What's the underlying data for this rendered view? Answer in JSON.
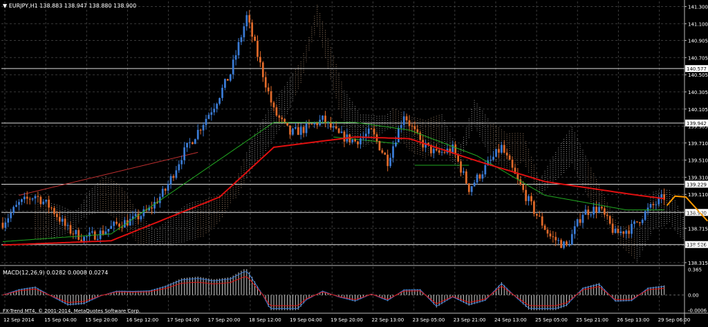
{
  "header": {
    "symbol_label": "EURJPY,H1",
    "ohlc": "138.883 138.947 138.880 138.900"
  },
  "macd_label": "MACD(12,26,9) 0.0282 0.0008 0.0274",
  "copyright": "FX-Trend MT4, © 2001-2014, MetaQuotes Software Corp.",
  "colors": {
    "background": "#000000",
    "grid": "#3a3a3a",
    "bull": "#3a7bd5",
    "bear": "#e06a2a",
    "ma_red": "#e01010",
    "ma_green": "#22aa22",
    "cloud_a": "#d9b08c",
    "cloud_b": "#d8d8d8",
    "forecast": "#ff9900"
  },
  "chart_data": {
    "type": "candlestick",
    "symbol": "EURJPY",
    "timeframe": "H1",
    "y_ticks": [
      "141.300",
      "141.100",
      "140.905",
      "140.705",
      "140.505",
      "140.305",
      "140.105",
      "139.905",
      "139.710",
      "139.510",
      "139.310",
      "139.110",
      "138.915",
      "138.715",
      "138.515",
      "138.315"
    ],
    "price_lines": [
      {
        "label": "140.577",
        "value": 140.577
      },
      {
        "label": "139.942",
        "value": 139.942
      },
      {
        "label": "139.229",
        "value": 139.229
      },
      {
        "label": "138.900",
        "value": 138.9
      },
      {
        "label": "138.526",
        "value": 138.526
      }
    ],
    "ylim": [
      138.29,
      141.36
    ],
    "x_labels": [
      "12 Sep 2014",
      "15 Sep 04:00",
      "15 Sep 20:00",
      "16 Sep 12:00",
      "17 Sep 04:00",
      "17 Sep 20:00",
      "18 Sep 12:00",
      "19 Sep 04:00",
      "19 Sep 20:00",
      "22 Sep 13:00",
      "23 Sep 05:00",
      "23 Sep 21:00",
      "24 Sep 13:00",
      "25 Sep 05:00",
      "25 Sep 21:00",
      "26 Sep 13:00",
      "29 Sep 06:00"
    ],
    "close_path": [
      [
        0,
        138.78
      ],
      [
        6,
        139.0
      ],
      [
        12,
        139.1
      ],
      [
        18,
        138.95
      ],
      [
        24,
        138.7
      ],
      [
        30,
        138.6
      ],
      [
        36,
        138.66
      ],
      [
        42,
        138.76
      ],
      [
        48,
        138.81
      ],
      [
        54,
        138.93
      ],
      [
        60,
        139.16
      ],
      [
        66,
        139.56
      ],
      [
        72,
        139.85
      ],
      [
        78,
        140.15
      ],
      [
        84,
        140.52
      ],
      [
        90,
        141.18
      ],
      [
        95,
        140.62
      ],
      [
        100,
        140.08
      ],
      [
        106,
        139.82
      ],
      [
        112,
        139.88
      ],
      [
        118,
        139.98
      ],
      [
        124,
        139.8
      ],
      [
        130,
        139.73
      ],
      [
        136,
        139.84
      ],
      [
        142,
        139.5
      ],
      [
        148,
        140.05
      ],
      [
        154,
        139.72
      ],
      [
        160,
        139.58
      ],
      [
        166,
        139.64
      ],
      [
        172,
        139.18
      ],
      [
        178,
        139.42
      ],
      [
        184,
        139.66
      ],
      [
        190,
        139.26
      ],
      [
        196,
        138.92
      ],
      [
        202,
        138.62
      ],
      [
        208,
        138.5
      ],
      [
        214,
        138.9
      ],
      [
        220,
        138.95
      ],
      [
        226,
        138.65
      ],
      [
        232,
        138.72
      ],
      [
        238,
        138.93
      ],
      [
        244,
        139.08
      ]
    ],
    "bars_total": 252,
    "ma_red": [
      [
        0,
        138.52
      ],
      [
        40,
        138.57
      ],
      [
        80,
        139.08
      ],
      [
        100,
        139.66
      ],
      [
        130,
        139.78
      ],
      [
        150,
        139.76
      ],
      [
        175,
        139.5
      ],
      [
        200,
        139.26
      ],
      [
        230,
        139.12
      ],
      [
        244,
        139.06
      ]
    ],
    "ma_green": [
      [
        0,
        138.56
      ],
      [
        40,
        138.65
      ],
      [
        70,
        139.3
      ],
      [
        100,
        139.95
      ],
      [
        130,
        139.95
      ],
      [
        150,
        139.86
      ],
      [
        175,
        139.56
      ],
      [
        200,
        139.1
      ],
      [
        230,
        138.93
      ],
      [
        244,
        138.93
      ]
    ],
    "forecast": [
      [
        245,
        138.98
      ],
      [
        248,
        139.09
      ],
      [
        252,
        139.08
      ],
      [
        260,
        138.8
      ]
    ],
    "trendlines": [
      {
        "from": [
          6,
          139.1
        ],
        "to": [
          72,
          139.6
        ],
        "color": "#c03030"
      },
      {
        "from": [
          122,
          139.78
        ],
        "to": [
          146,
          139.7
        ],
        "color": "#22aa22"
      },
      {
        "from": [
          152,
          139.45
        ],
        "to": [
          172,
          139.45
        ],
        "color": "#22aa22"
      }
    ],
    "macd": {
      "label": "MACD(12,26,9) 0.0282 0.0008 0.0274",
      "axis_ticks": [
        "0.365",
        "0.00",
        "-0.0006"
      ],
      "ylim": [
        -0.23,
        0.37
      ]
    }
  }
}
